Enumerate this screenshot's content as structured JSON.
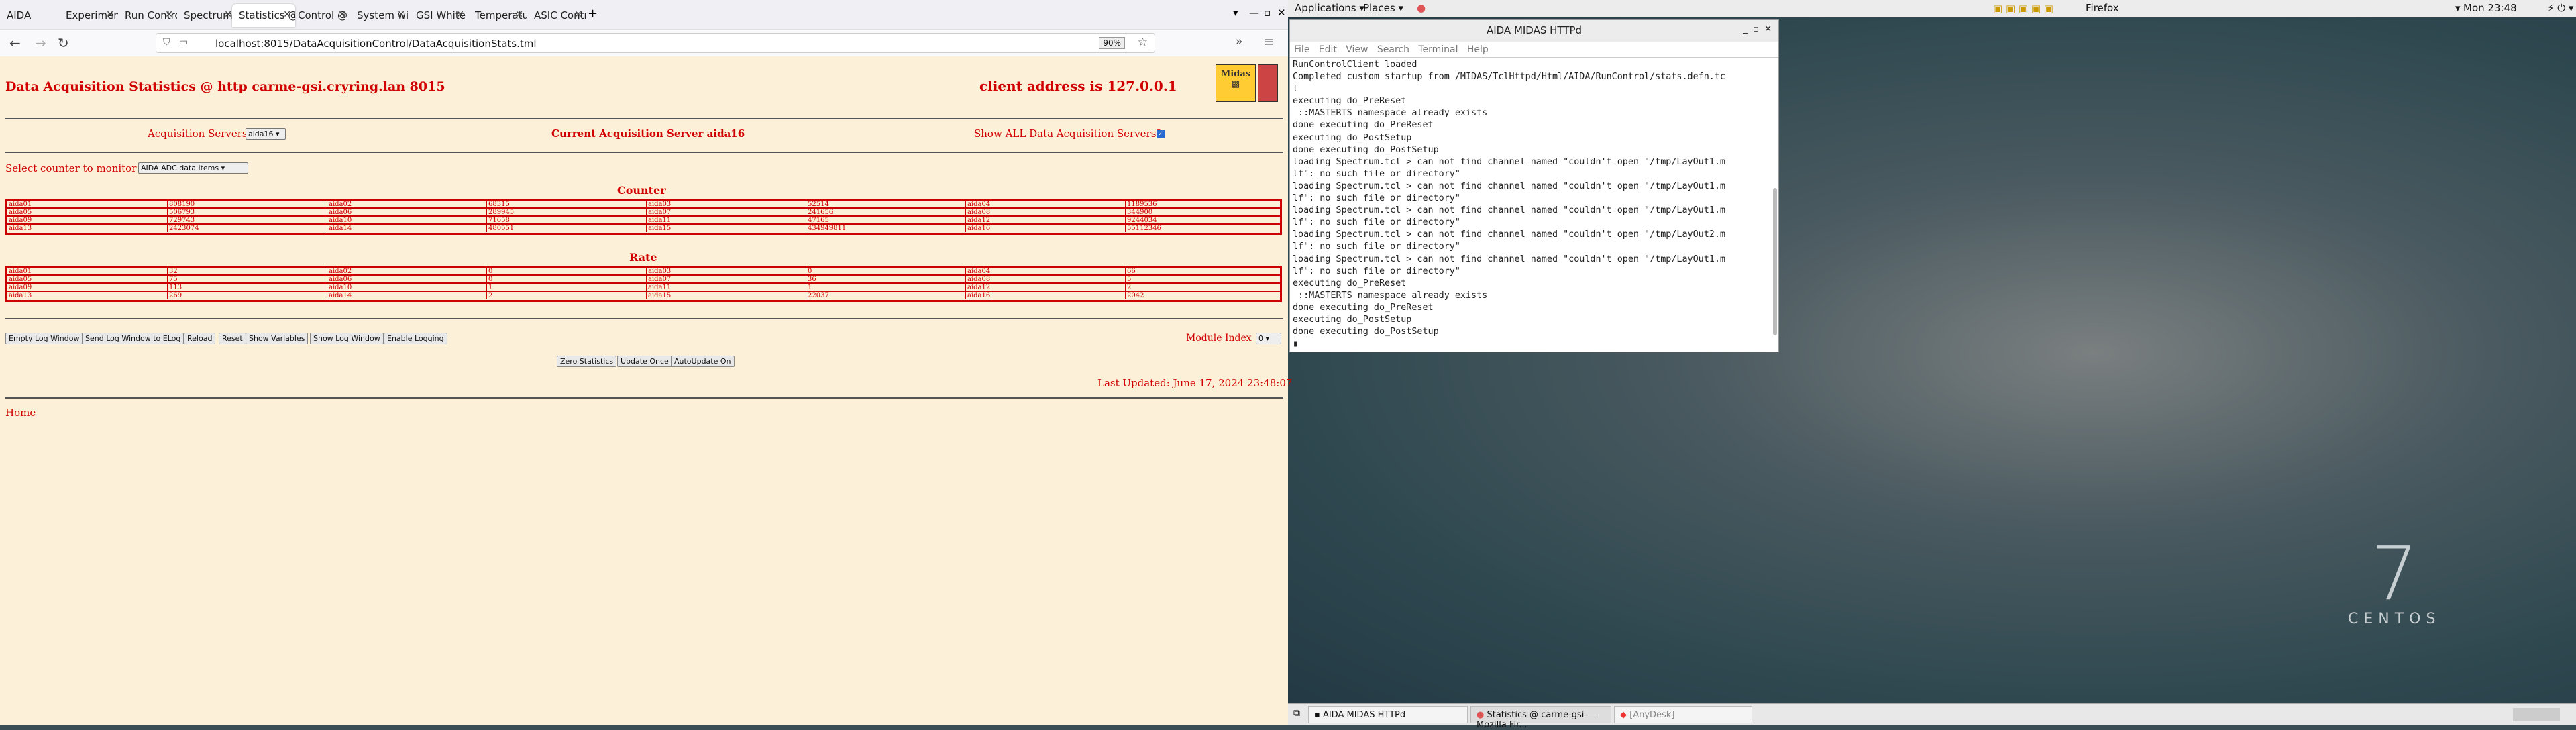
{
  "browser": {
    "tabs": [
      "AIDA",
      "Experiment Control @",
      "Run Control @ carm",
      "Spectrum Browser @",
      "Statistics @ carme-gs",
      "Control @ carme-gsi",
      "System wide Checks",
      "GSI White Rabbit Tim",
      "Temperature and stat",
      "ASIC Control @ carm"
    ],
    "new_tab": "+",
    "url": "localhost:8015/DataAcquisitionControl/DataAcquisitionStats.tml",
    "zoom": "90%"
  },
  "page": {
    "title": "Data Acquisition Statistics @ http carme-gsi.cryring.lan 8015",
    "client_address": "client address is 127.0.0.1",
    "logo_text": "Midas",
    "acq_servers_label": "Acquisition Servers",
    "acq_server_value": "aida16",
    "current_server": "Current Acquisition Server aida16",
    "show_all": "Show ALL Data Acquisition Servers?",
    "counter_label": "Select counter to monitor",
    "counter_value": "AIDA ADC data items",
    "counter_heading": "Counter",
    "rate_heading": "Rate",
    "counter_rows": [
      [
        "aida01",
        "808190",
        "aida02",
        "68315",
        "aida03",
        "52514",
        "aida04",
        "1189536"
      ],
      [
        "aida05",
        "506793",
        "aida06",
        "289945",
        "aida07",
        "241656",
        "aida08",
        "344900"
      ],
      [
        "aida09",
        "729743",
        "aida10",
        "71658",
        "aida11",
        "47165",
        "aida12",
        "9244034"
      ],
      [
        "aida13",
        "2423074",
        "aida14",
        "480551",
        "aida15",
        "434949811",
        "aida16",
        "55112346"
      ]
    ],
    "rate_rows": [
      [
        "aida01",
        "32",
        "aida02",
        "0",
        "aida03",
        "0",
        "aida04",
        "66"
      ],
      [
        "aida05",
        "75",
        "aida06",
        "0",
        "aida07",
        "36",
        "aida08",
        "5"
      ],
      [
        "aida09",
        "113",
        "aida10",
        "1",
        "aida11",
        "1",
        "aida12",
        "2"
      ],
      [
        "aida13",
        "269",
        "aida14",
        "2",
        "aida15",
        "22037",
        "aida16",
        "2042"
      ]
    ],
    "buttons": [
      "Empty Log Window",
      "Send Log Window to ELog",
      "Reload",
      "Reset",
      "Show Variables",
      "Show Log Window",
      "Enable Logging"
    ],
    "module_index_label": "Module Index",
    "module_index_value": "0",
    "buttons2": [
      "Zero Statistics",
      "Update Once",
      "AutoUpdate On"
    ],
    "last_updated": "Last Updated: June 17, 2024 23:48:07",
    "home_link": "Home"
  },
  "gnome": {
    "applications": "Applications",
    "places": "Places",
    "firefox": "Firefox",
    "clock": "Mon 23:48"
  },
  "terminal": {
    "title": "AIDA MIDAS HTTPd",
    "menu": [
      "File",
      "Edit",
      "View",
      "Search",
      "Terminal",
      "Help"
    ],
    "lines": [
      "RunControlClient loaded",
      "Completed custom startup from /MIDAS/TclHttpd/Html/AIDA/RunControl/stats.defn.tc",
      "l",
      "executing do_PreReset",
      " ::MASTERTS namespace already exists",
      "done executing do_PreReset",
      "executing do_PostSetup",
      "done executing do_PostSetup",
      "loading Spectrum.tcl > can not find channel named \"couldn't open \"/tmp/LayOut1.m",
      "lf\": no such file or directory\"",
      "loading Spectrum.tcl > can not find channel named \"couldn't open \"/tmp/LayOut1.m",
      "lf\": no such file or directory\"",
      "loading Spectrum.tcl > can not find channel named \"couldn't open \"/tmp/LayOut1.m",
      "lf\": no such file or directory\"",
      "loading Spectrum.tcl > can not find channel named \"couldn't open \"/tmp/LayOut2.m",
      "lf\": no such file or directory\"",
      "loading Spectrum.tcl > can not find channel named \"couldn't open \"/tmp/LayOut1.m",
      "lf\": no such file or directory\"",
      "executing do_PreReset",
      " ::MASTERTS namespace already exists",
      "done executing do_PreReset",
      "executing do_PostSetup",
      "done executing do_PostSetup"
    ]
  },
  "desktop": {
    "logo_number": "7",
    "logo_text": "CENTOS"
  },
  "taskbar": [
    "AIDA MIDAS HTTPd",
    "Statistics @ carme-gsi — Mozilla Fir...",
    "[AnyDesk]"
  ]
}
